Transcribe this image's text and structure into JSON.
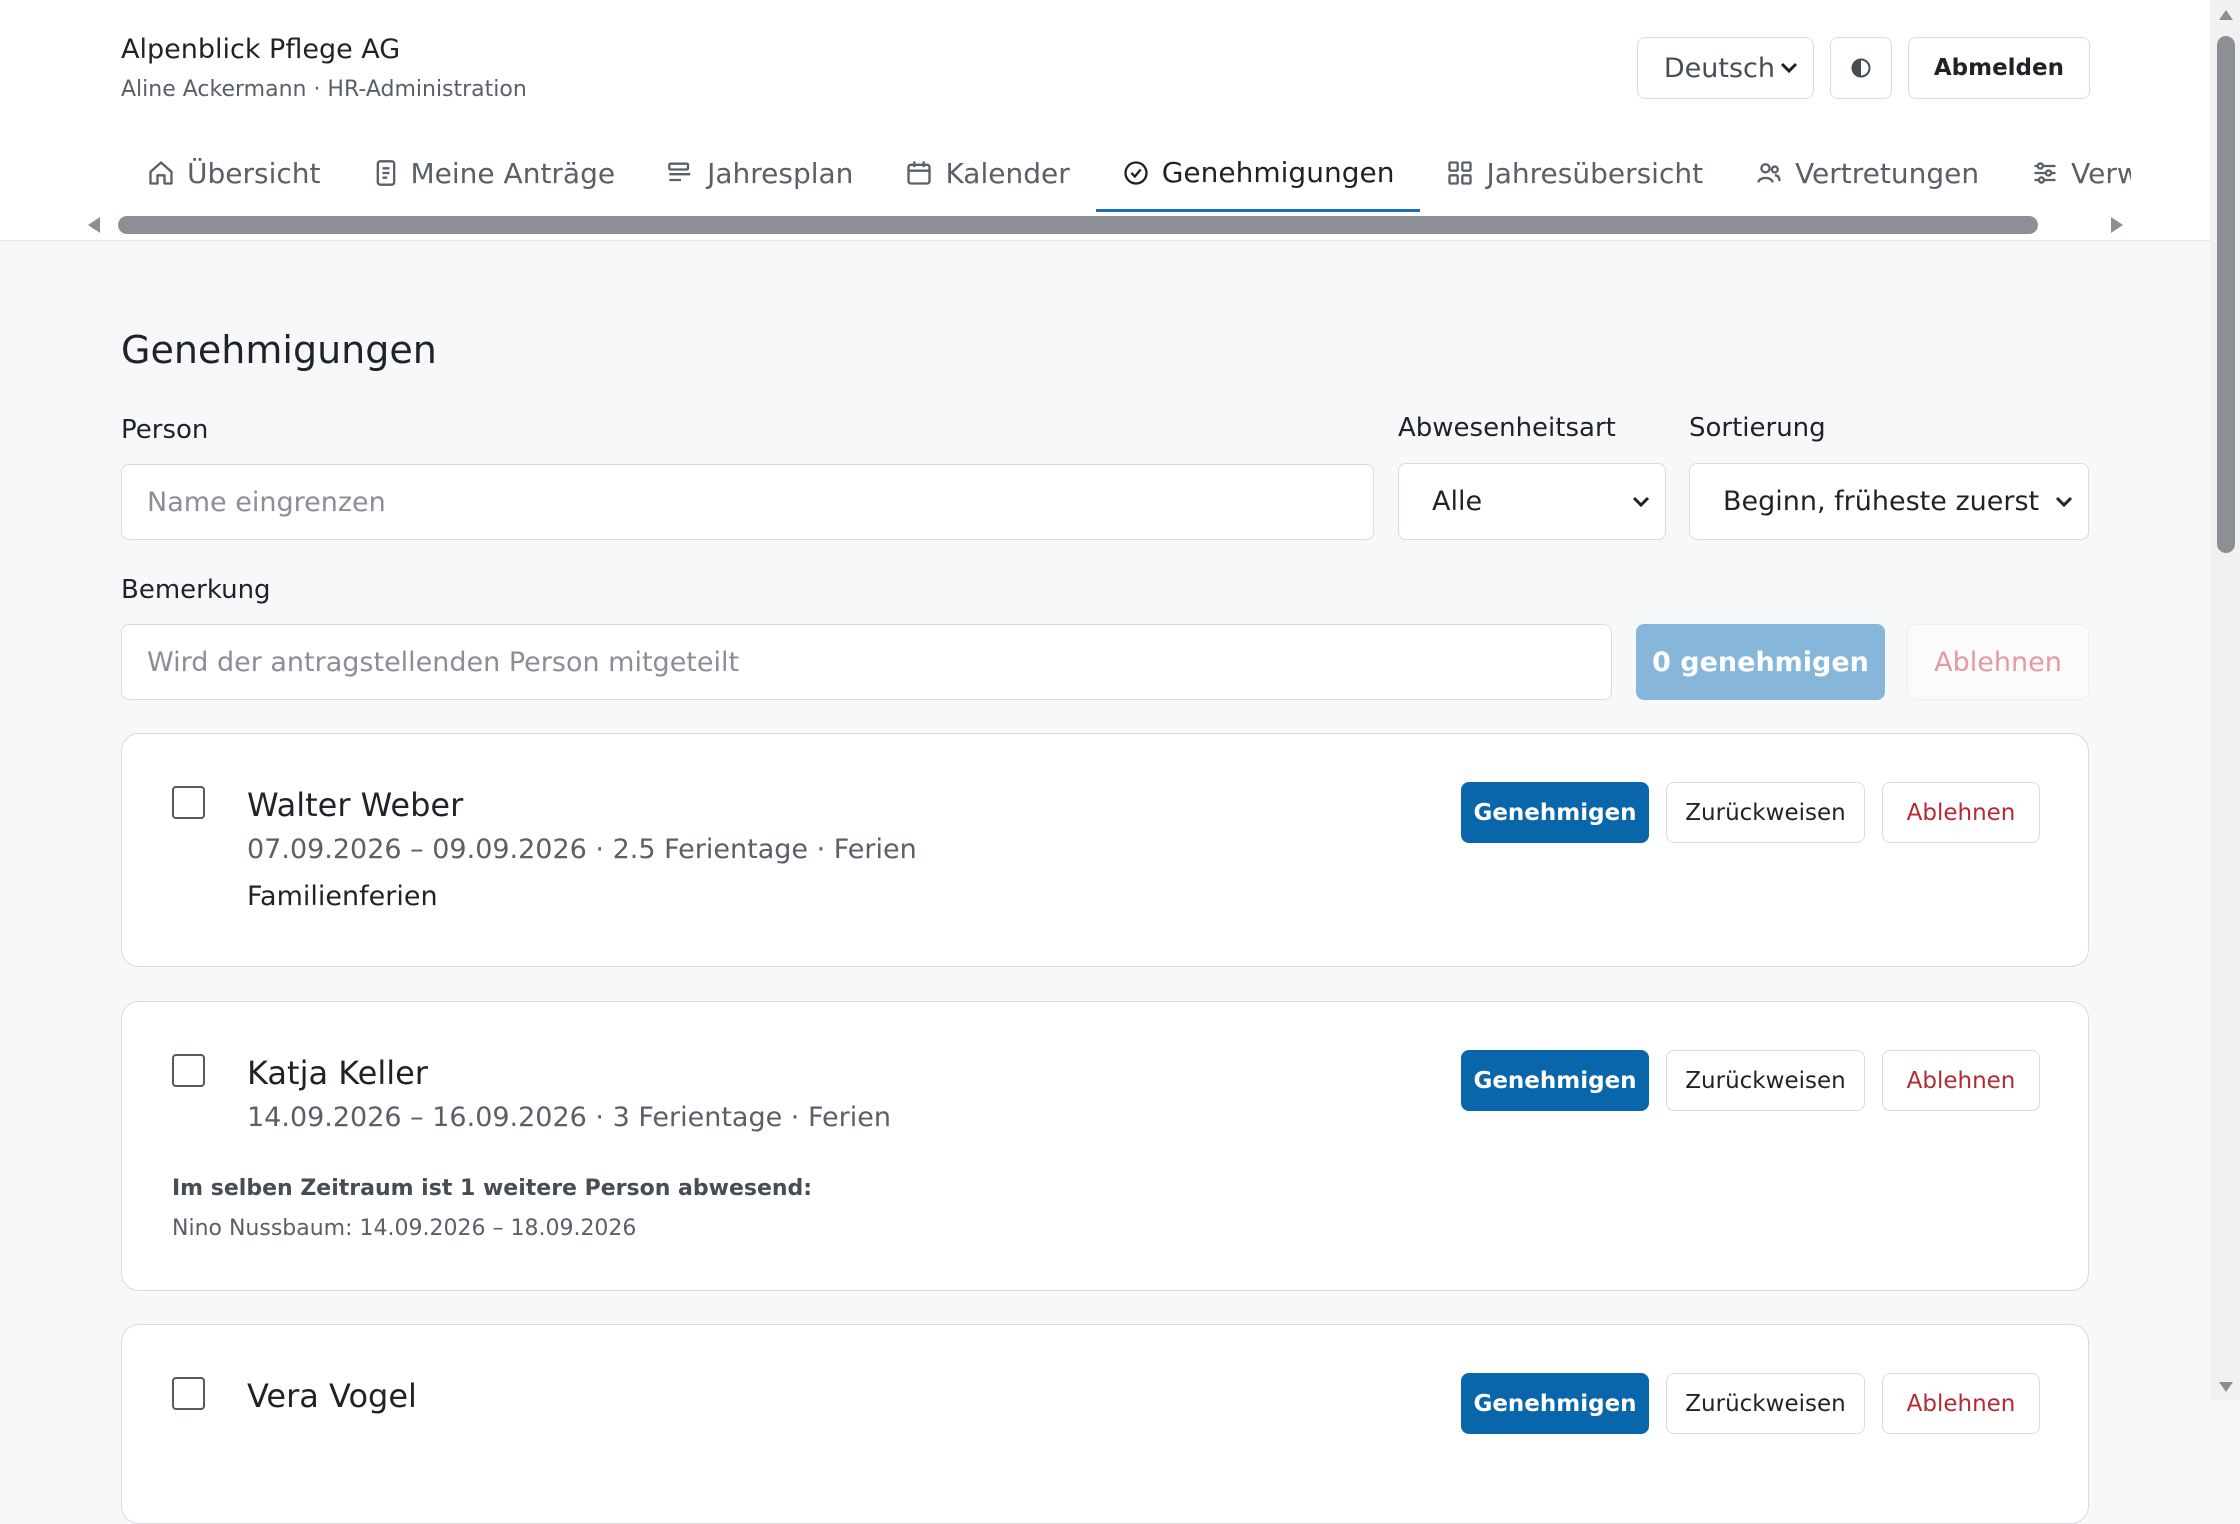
{
  "header": {
    "org_name": "Alpenblick Pflege AG",
    "user_line": "Aline Ackermann · HR-Administration",
    "language": "Deutsch",
    "logout_label": "Abmelden"
  },
  "tabs": [
    {
      "label": "Übersicht",
      "icon": "home-icon"
    },
    {
      "label": "Meine Anträge",
      "icon": "document-icon"
    },
    {
      "label": "Jahresplan",
      "icon": "timeline-icon"
    },
    {
      "label": "Kalender",
      "icon": "calendar-icon"
    },
    {
      "label": "Genehmigungen",
      "icon": "check-circle-icon",
      "active": true
    },
    {
      "label": "Jahresübersicht",
      "icon": "grid-icon"
    },
    {
      "label": "Vertretungen",
      "icon": "people-icon"
    },
    {
      "label": "Verwaltu",
      "icon": "sliders-icon"
    }
  ],
  "page": {
    "title": "Genehmigungen"
  },
  "filters": {
    "person_label": "Person",
    "person_placeholder": "Name eingrenzen",
    "type_label": "Abwesenheitsart",
    "type_value": "Alle",
    "sort_label": "Sortierung",
    "sort_value": "Beginn, früheste zuerst",
    "remark_label": "Bemerkung",
    "remark_placeholder": "Wird der antragstellenden Person mitgeteilt",
    "approve_all_label": "0 genehmigen",
    "reject_all_label": "Ablehnen"
  },
  "requests": [
    {
      "name": "Walter Weber",
      "meta": "07.09.2026 – 09.09.2026 · 2.5 Ferientage · Ferien",
      "note": "Familienferien",
      "approve_label": "Genehmigen",
      "return_label": "Zurückweisen",
      "reject_label": "Ablehnen"
    },
    {
      "name": "Katja Keller",
      "meta": "14.09.2026 – 16.09.2026 · 3 Ferientage · Ferien",
      "overlap_title": "Im selben Zeitraum ist 1 weitere Person abwesend:",
      "overlap_item": "Nino Nussbaum: 14.09.2026 – 18.09.2026",
      "approve_label": "Genehmigen",
      "return_label": "Zurückweisen",
      "reject_label": "Ablehnen"
    },
    {
      "name": "Vera Vogel",
      "approve_label": "Genehmigen",
      "return_label": "Zurückweisen",
      "reject_label": "Ablehnen"
    }
  ],
  "colors": {
    "primary": "#0a66aa",
    "danger": "#b42a33",
    "active_tab_underline": "#1f6fb0"
  }
}
